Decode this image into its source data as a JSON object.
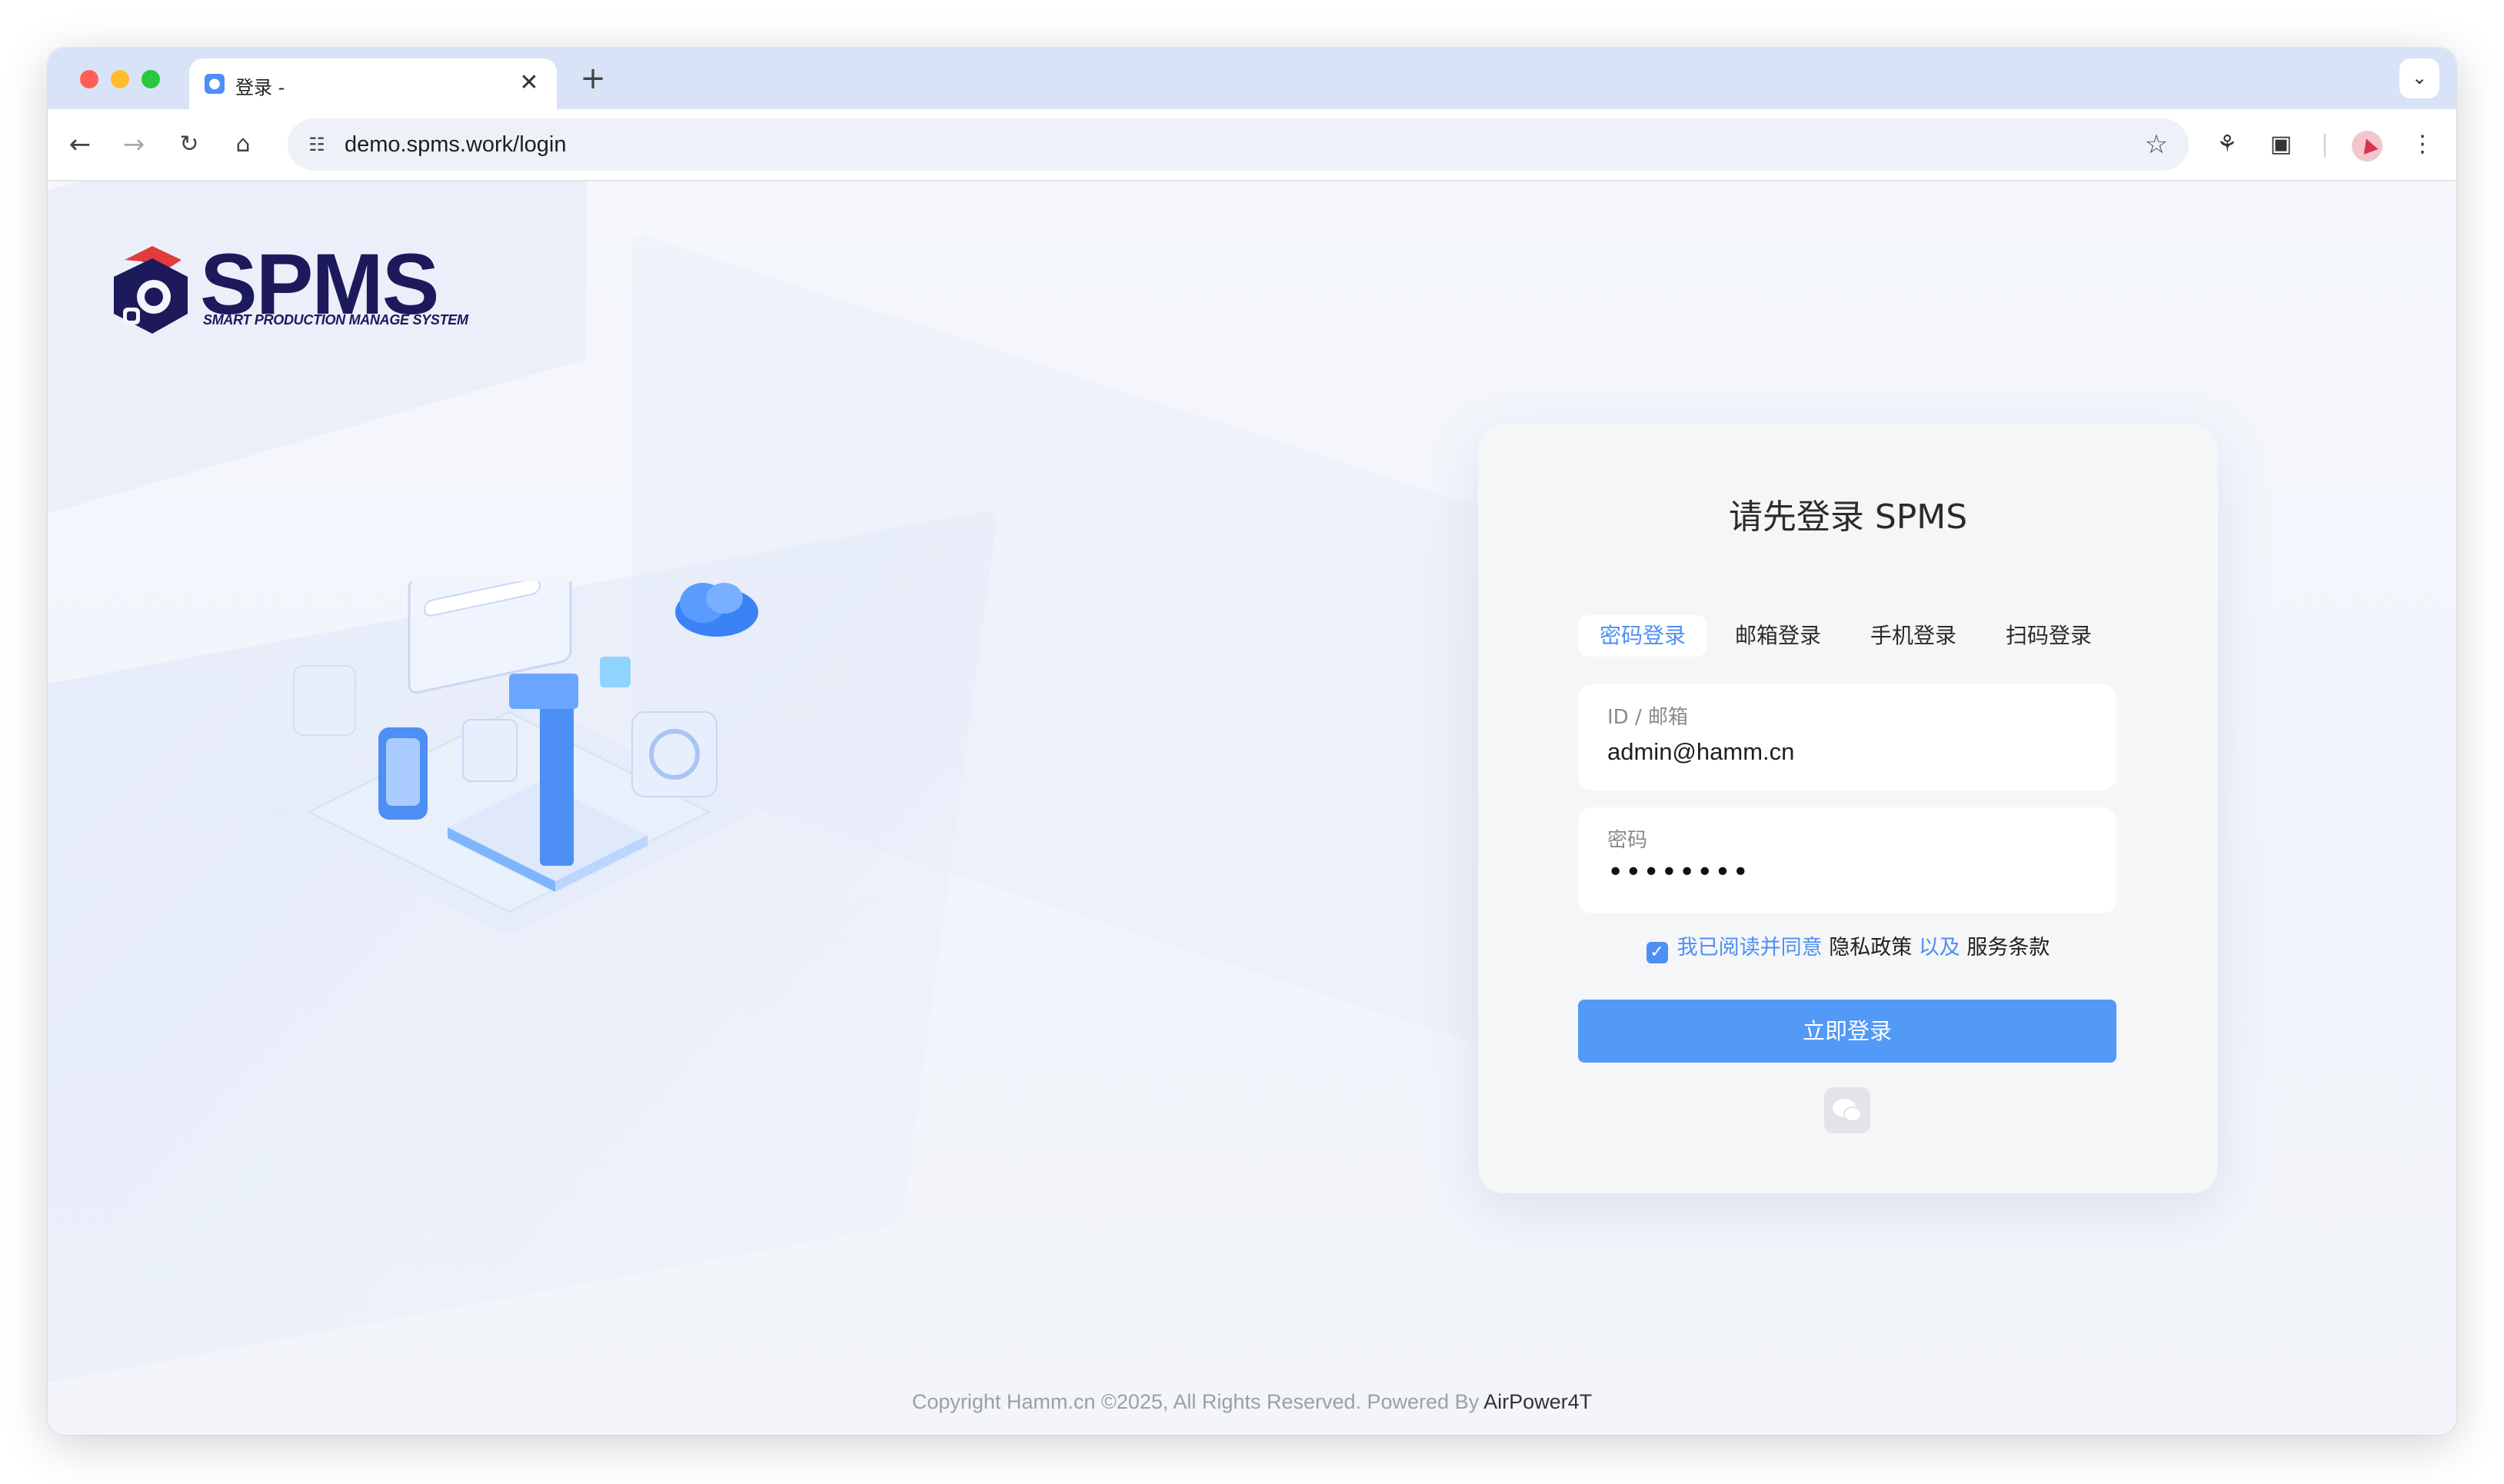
{
  "browser": {
    "tab_title": "登录 -",
    "url": "demo.spms.work/login"
  },
  "logo": {
    "name": "SPMS",
    "tagline": "SMART PRODUCTION MANAGE SYSTEM"
  },
  "login": {
    "title": "请先登录 SPMS",
    "tabs": [
      "密码登录",
      "邮箱登录",
      "手机登录",
      "扫码登录"
    ],
    "active_tab": "密码登录",
    "id_label": "ID / 邮箱",
    "id_value": "admin@hamm.cn",
    "password_label": "密码",
    "password_value": "••••••••",
    "agree_prefix": "我已阅读并同意",
    "privacy": "隐私政策",
    "and": "以及",
    "terms": "服务条款",
    "agree_checked": true,
    "submit_label": "立即登录"
  },
  "footer": {
    "copyright": "Copyright Hamm.cn ©2025, All Rights Reserved. Powered By",
    "brand": "AirPower4T"
  },
  "colors": {
    "accent": "#4d8ff4",
    "button": "#5399f6",
    "logo_navy": "#1d1a5c",
    "logo_red": "#e23b3b"
  }
}
